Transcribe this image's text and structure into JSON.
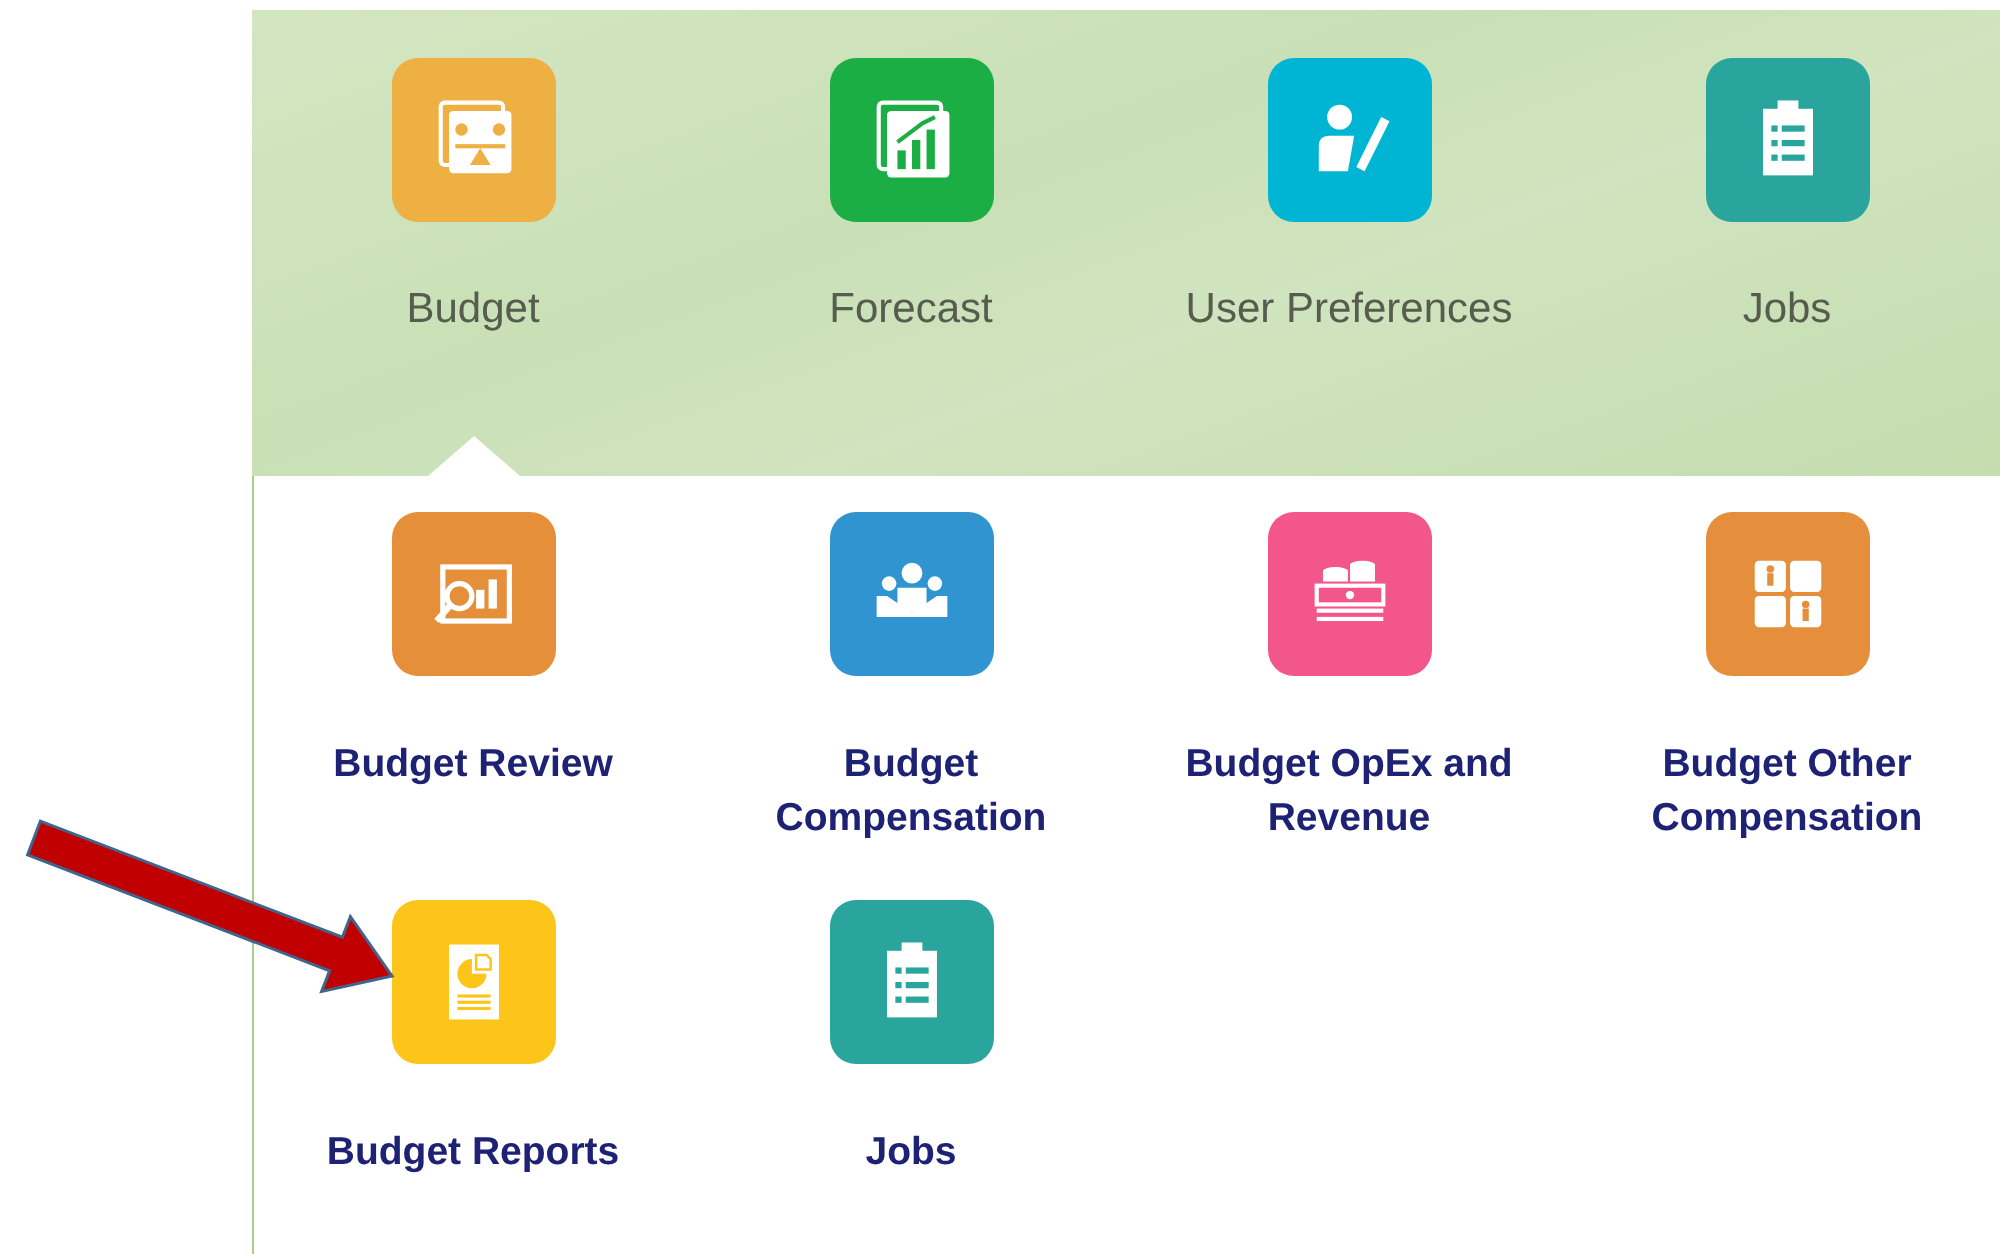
{
  "nav": [
    {
      "label": "Budget",
      "color": "#eeb043",
      "selected": true
    },
    {
      "label": "Forecast",
      "color": "#1aae45",
      "selected": false
    },
    {
      "label": "User Preferences",
      "color": "#00b5d4",
      "selected": false
    },
    {
      "label": "Jobs",
      "color": "#2aa59e",
      "selected": false
    }
  ],
  "tiles": [
    {
      "label": "Budget Review",
      "color": "#e68f3b"
    },
    {
      "label": "Budget Compensation",
      "color": "#2f94d0"
    },
    {
      "label": "Budget OpEx and Revenue",
      "color": "#f2568a"
    },
    {
      "label": "Budget Other Compensation",
      "color": "#e58f3d"
    },
    {
      "label": "Budget Reports",
      "color": "#fdc51a"
    },
    {
      "label": "Jobs",
      "color": "#2aa59e"
    }
  ]
}
